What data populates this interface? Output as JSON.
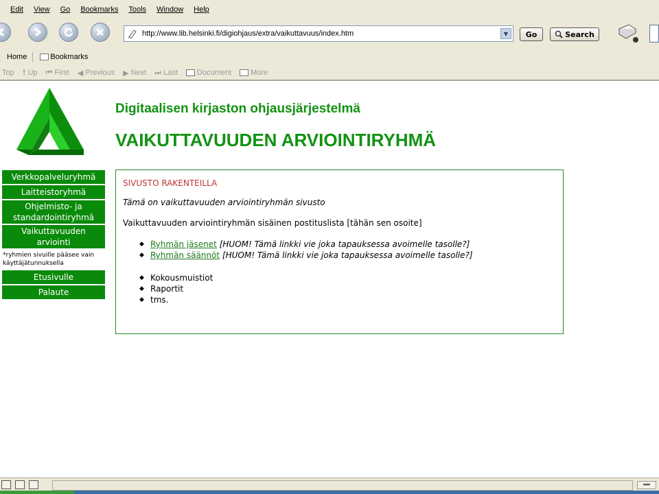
{
  "menu": {
    "items": [
      {
        "label": "Edit"
      },
      {
        "label": "View"
      },
      {
        "label": "Go"
      },
      {
        "label": "Bookmarks"
      },
      {
        "label": "Tools"
      },
      {
        "label": "Window"
      },
      {
        "label": "Help"
      }
    ]
  },
  "navigation": {
    "url": "http://www.lib.helsinki.fi/digiohjaus/extra/vaikuttavuus/index.htm",
    "go_label": "Go",
    "search_label": "Search",
    "buttons": {
      "back": "back-icon",
      "forward": "forward-icon",
      "reload": "reload-icon",
      "stop": "stop-icon"
    }
  },
  "personal_toolbar": {
    "home": "Home",
    "bookmarks": "Bookmarks"
  },
  "site_nav_bar": {
    "items": [
      "Top",
      "Up",
      "First",
      "Previous",
      "Next",
      "Last",
      "Document",
      "More"
    ]
  },
  "page": {
    "subtitle": "Digitaalisen kirjaston ohjausjärjestelmä",
    "title": "VAIKUTTAVUUDEN ARVIOINTIRYHMÄ",
    "colors": {
      "brand_green": "#129212",
      "nav_green": "#0a8a0a",
      "construction_red": "#c23434"
    }
  },
  "sidebar": {
    "items": [
      {
        "label": "Verkkopalveluryhmä"
      },
      {
        "label": "Laitteistoryhmä"
      },
      {
        "label": "Ohjelmisto- ja standardointiryhmä"
      },
      {
        "label": "Vaikuttavuuden arviointi"
      }
    ],
    "note": "*ryhmien sivuille pääsee vain käyttäjätunnuksella",
    "bottom_items": [
      {
        "label": "Etusivulle"
      },
      {
        "label": "Palaute"
      }
    ]
  },
  "content": {
    "construction": "SIVUSTO RAKENTEILLA",
    "intro": "Tämä on vaikuttavuuden arviointiryhmän sivusto",
    "mailing_list": "Vaikuttavuuden arviointiryhmän sisäinen postituslista [tähän sen osoite]",
    "links": [
      {
        "label": "Ryhmän jäsenet",
        "note": "[HUOM! Tämä linkki vie joka tapauksessa avoimelle tasolle?]"
      },
      {
        "label": "Ryhmän säännöt",
        "note": "[HUOM! Tämä linkki vie joka tapauksessa avoimelle tasolle?]"
      }
    ],
    "items": [
      "Kokousmuistiot",
      "Raportit",
      "tms."
    ]
  }
}
